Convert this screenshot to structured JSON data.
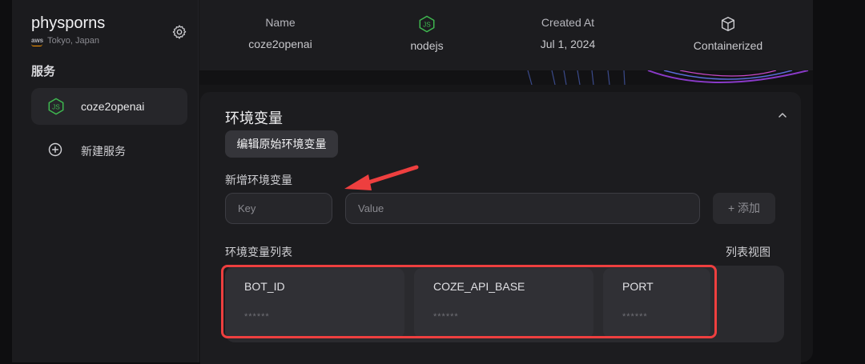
{
  "sidebar": {
    "project_name": "physporns",
    "region_provider": "aws",
    "region": "Tokyo, Japan",
    "section_label": "服务",
    "items": [
      {
        "label": "coze2openai",
        "icon": "nodejs-icon",
        "active": true
      },
      {
        "label": "新建服务",
        "icon": "plus-circle-icon",
        "active": false
      }
    ]
  },
  "header": {
    "columns": [
      {
        "title": "Name",
        "value": "coze2openai"
      },
      {
        "title": "",
        "value": "nodejs",
        "icon": "nodejs-icon"
      },
      {
        "title": "Created At",
        "value": "Jul 1, 2024"
      },
      {
        "title": "",
        "value": "Containerized",
        "icon": "container-icon"
      }
    ]
  },
  "env": {
    "title": "环境变量",
    "edit_raw_label": "编辑原始环境变量",
    "add_label": "新增环境变量",
    "key_placeholder": "Key",
    "value_placeholder": "Value",
    "add_button_label": "+ 添加",
    "list_label": "环境变量列表",
    "list_view_label": "列表视图",
    "variables": [
      {
        "key": "BOT_ID",
        "masked": "******"
      },
      {
        "key": "COZE_API_BASE",
        "masked": "******"
      },
      {
        "key": "PORT",
        "masked": "******"
      }
    ]
  },
  "colors": {
    "accent_green": "#3fb950",
    "annotation_red": "#ee3f3f"
  }
}
